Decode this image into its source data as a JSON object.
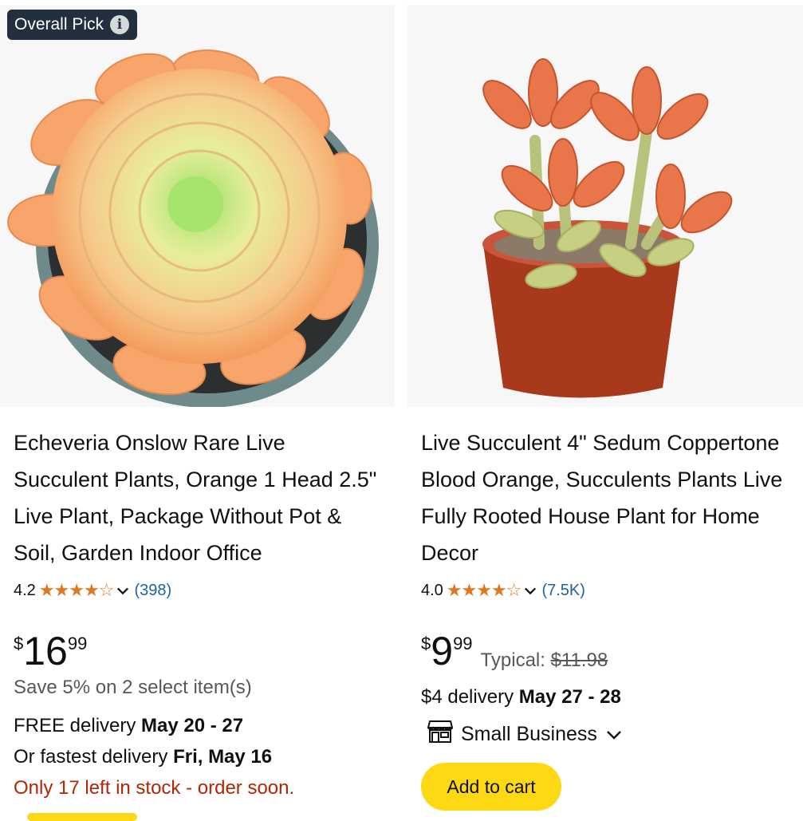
{
  "products": [
    {
      "badge": "Overall Pick",
      "title": "Echeveria Onslow Rare Live Succulent Plants, Orange 1 Head 2.5\" Live Plant, Package Without Pot & Soil, Garden Indoor Office",
      "rating": "4.2",
      "stars": "★★★★☆",
      "review_count": "(398)",
      "price_symbol": "$",
      "price_whole": "16",
      "price_fraction": "99",
      "save_text": "Save 5% on 2 select item(s)",
      "delivery_prefix": "FREE delivery ",
      "delivery_dates": "May 20 - 27",
      "fastest_prefix": "Or fastest delivery ",
      "fastest_date": "Fri, May 16",
      "stock_text": "Only 17 left in stock - order soon."
    },
    {
      "title": "Live Succulent 4\" Sedum Coppertone Blood Orange, Succulents Plants Live Fully Rooted House Plant for Home Decor",
      "rating": "4.0",
      "stars": "★★★★☆",
      "review_count": "(7.5K)",
      "price_symbol": "$",
      "price_whole": "9",
      "price_fraction": "99",
      "typical_label": "Typical: ",
      "typical_price": "$11.98",
      "delivery_prefix": "$4 delivery ",
      "delivery_dates": "May 27 - 28",
      "small_business": "Small Business",
      "add_to_cart": "Add to cart"
    }
  ],
  "colors": {
    "star": "#de7921",
    "link": "#2162a1",
    "stock": "#b12704",
    "button": "#ffd814",
    "badge": "#232f3e"
  }
}
